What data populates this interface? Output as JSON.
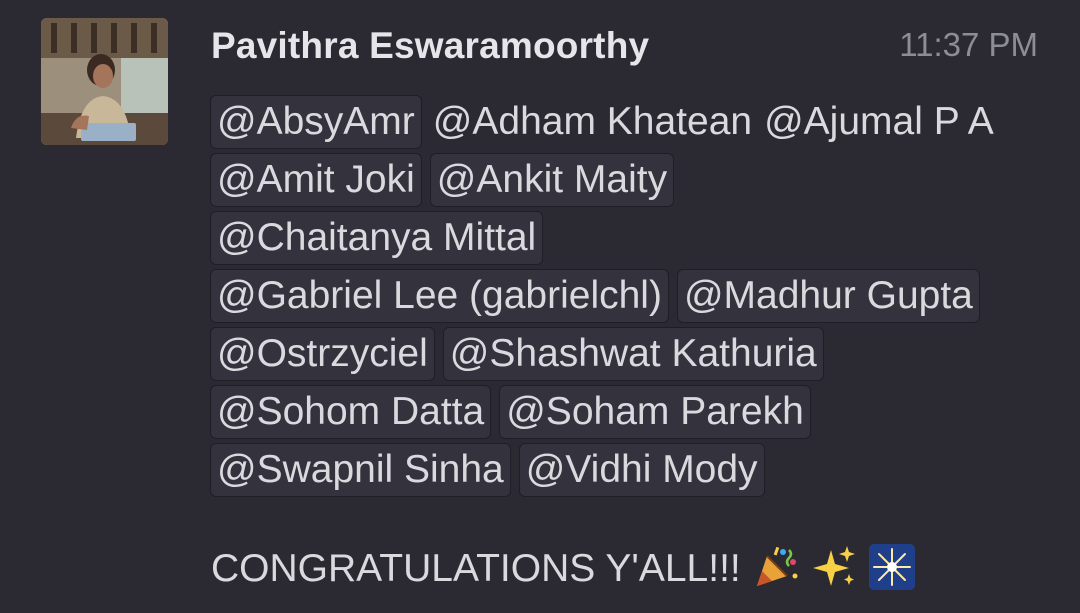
{
  "message": {
    "author": "Pavithra Eswaramoorthy",
    "timestamp": "11:37 PM",
    "mention_lines": [
      [
        {
          "text": "@AbsyAmr",
          "chip": true
        },
        {
          "text": "@Adham Khatean",
          "chip": false
        },
        {
          "text": "@Ajumal P A",
          "chip": false
        }
      ],
      [
        {
          "text": "@Amit Joki",
          "chip": true
        },
        {
          "text": "@Ankit Maity",
          "chip": true
        }
      ],
      [
        {
          "text": "@Chaitanya Mittal",
          "chip": true
        }
      ],
      [
        {
          "text": "@Gabriel Lee (gabrielchl)",
          "chip": true
        },
        {
          "text": "@Madhur Gupta",
          "chip": true
        }
      ],
      [
        {
          "text": "@Ostrzyciel",
          "chip": true
        },
        {
          "text": "@Shashwat Kathuria",
          "chip": true
        }
      ],
      [
        {
          "text": "@Sohom Datta",
          "chip": true
        },
        {
          "text": "@Soham Parekh",
          "chip": true
        }
      ],
      [
        {
          "text": "@Swapnil Sinha",
          "chip": true
        },
        {
          "text": "@Vidhi Mody",
          "chip": true
        }
      ]
    ],
    "body_text": "CONGRATULATIONS Y'ALL!!!",
    "emojis": [
      "party-popper-icon",
      "sparkles-icon",
      "fireworks-icon"
    ]
  },
  "colors": {
    "background": "#2b2a33",
    "mention_chip": "#34333d",
    "text": "#d9d9de",
    "timestamp": "#8d8d95"
  }
}
